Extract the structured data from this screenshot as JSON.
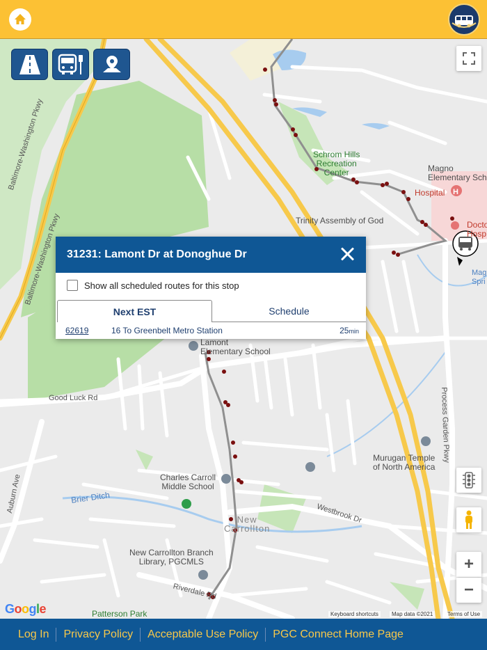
{
  "header": {
    "home_icon": "home-icon",
    "logo": "pgc-connect-bus-logo"
  },
  "layer_buttons": [
    {
      "icon": "road-icon"
    },
    {
      "icon": "bus-stop-icon"
    },
    {
      "icon": "map-pin-icon"
    }
  ],
  "map": {
    "labels": {
      "gw_pkwy_1": "Baltimore-Washington Pkwy",
      "gw_pkwy_2": "Baltimore-Washington Pkwy",
      "good_luck": "Good Luck Rd",
      "schrom": "Schrom Hills\nRecreation\nCenter",
      "trinity": "Trinity Assembly of God",
      "magnolia": "Magno\nElementary Scho",
      "hospital": "Hospital",
      "doctors": "Docto\nHosp",
      "lamont": "Lamont\nElementary School",
      "carroll": "Charles Carroll\nMiddle School",
      "murugan": "Murugan Temple\nof North America",
      "library": "New Carrollton Branch\nLibrary, PGCMLS",
      "new_carrollton": "New\nCarrollton",
      "patterson": "Patterson Park",
      "brier": "Brier Ditch",
      "westbrook": "Westbrook Dr",
      "process_garden": "Process Garden Pkwy",
      "auburn": "Auburn Ave",
      "riverdale": "Riverdale Rd",
      "magnolia_spring": "Magno\nSpri"
    },
    "attribution": {
      "shortcuts": "Keyboard shortcuts",
      "data": "Map data ©2021",
      "terms": "Terms of Use"
    },
    "google": "Google"
  },
  "popup": {
    "title": "31231: Lamont Dr at Donoghue Dr",
    "checkbox_label": "Show all scheduled routes for this stop",
    "tabs": [
      "Next EST",
      "Schedule"
    ],
    "predictions": [
      {
        "vehicle": "62619",
        "route": "16 To Greenbelt Metro Station",
        "minutes": "25",
        "unit": "min"
      }
    ]
  },
  "map_controls": {
    "fullscreen": "fullscreen-icon",
    "traffic": "traffic-light-icon",
    "pegman": "pegman-icon",
    "zoom_in": "+",
    "zoom_out": "−"
  },
  "footer": {
    "links": [
      "Log In",
      "Privacy Policy",
      "Acceptable Use Policy",
      "PGC Connect Home Page"
    ]
  },
  "colors": {
    "header": "#fcc134",
    "primary": "#0f5795",
    "link": "#f8c84a",
    "stop_dot": "#7a1010"
  }
}
